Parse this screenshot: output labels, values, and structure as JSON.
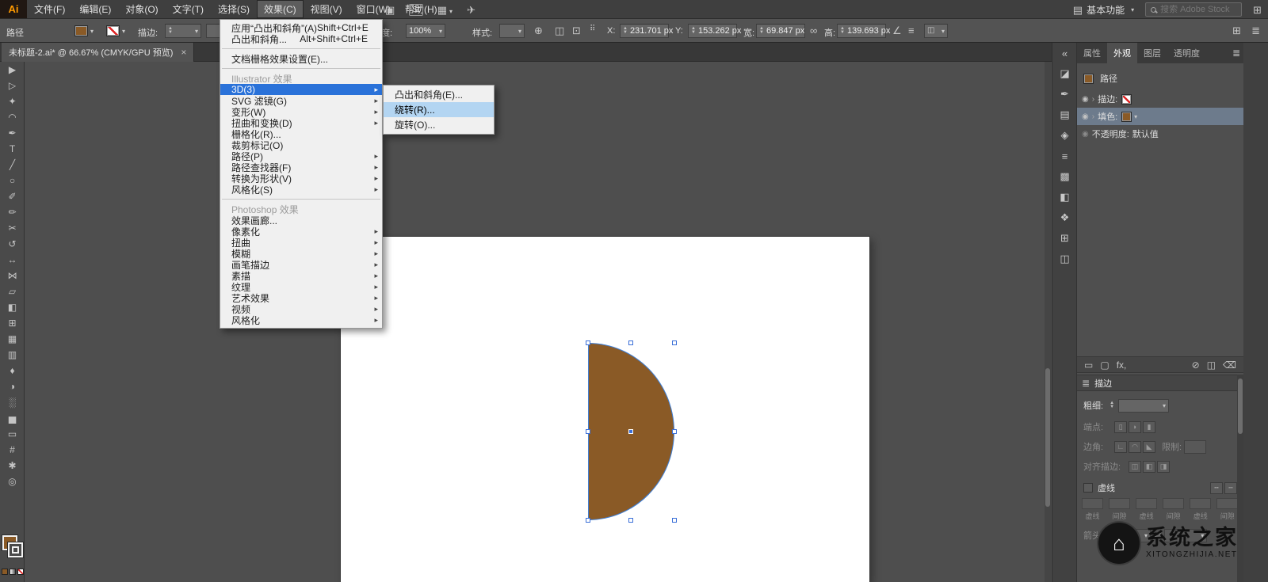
{
  "app": {
    "doc_tab_title": "未标题-2.ai* @ 66.67% (CMYK/GPU 预览)",
    "doc_tab_close": "×"
  },
  "colors": {
    "shape_brown": "#8a5a26",
    "selection_blue": "#3f7fd6",
    "menu_highlight": "#2a72d9",
    "menu_highlight_light": "#b3d5f2",
    "appearance_selected_row": "#6d7b8c"
  },
  "menubar": {
    "logo": "Ai",
    "menus": [
      {
        "label": "文件(F)"
      },
      {
        "label": "编辑(E)"
      },
      {
        "label": "对象(O)"
      },
      {
        "label": "文字(T)"
      },
      {
        "label": "选择(S)"
      },
      {
        "label": "效果(C)",
        "state": "active"
      },
      {
        "label": "视图(V)"
      },
      {
        "label": "窗口(W)"
      },
      {
        "label": "帮助(H)"
      }
    ],
    "stock_badge": "St",
    "workspace_label": "基本功能",
    "search_placeholder": "搜索 Adobe Stock"
  },
  "controlbar": {
    "object_label": "路径",
    "stroke_label": "描边:",
    "opacity_label": "不透明度:",
    "opacity_value": "100%",
    "style_label": "样式:",
    "x_label": "X:",
    "x_value": "231.701 px",
    "y_label": "Y:",
    "y_value": "153.262 px",
    "w_label": "宽:",
    "w_value": "69.847 px",
    "h_label": "高:",
    "h_value": "139.693 px"
  },
  "toolbar": {
    "tools": [
      {
        "name": "selection-tool",
        "glyph": "▶"
      },
      {
        "name": "direct-selection-tool",
        "glyph": "▷"
      },
      {
        "name": "magic-wand-tool",
        "glyph": "✦"
      },
      {
        "name": "lasso-tool",
        "glyph": "◠"
      },
      {
        "name": "pen-tool",
        "glyph": "✒"
      },
      {
        "name": "type-tool",
        "glyph": "T"
      },
      {
        "name": "line-segment-tool",
        "glyph": "╱"
      },
      {
        "name": "ellipse-tool",
        "glyph": "○"
      },
      {
        "name": "paintbrush-tool",
        "glyph": "✐"
      },
      {
        "name": "pencil-tool",
        "glyph": "✏"
      },
      {
        "name": "scissors-tool",
        "glyph": "✂"
      },
      {
        "name": "rotate-tool",
        "glyph": "↺"
      },
      {
        "name": "scale-tool",
        "glyph": "↔"
      },
      {
        "name": "width-tool",
        "glyph": "⋈"
      },
      {
        "name": "free-transform-tool",
        "glyph": "▱"
      },
      {
        "name": "shape-builder-tool",
        "glyph": "◧"
      },
      {
        "name": "perspective-grid-tool",
        "glyph": "⊞"
      },
      {
        "name": "mesh-tool",
        "glyph": "▦"
      },
      {
        "name": "gradient-tool",
        "glyph": "▥"
      },
      {
        "name": "eyedropper-tool",
        "glyph": "♦"
      },
      {
        "name": "blend-tool",
        "glyph": "◑"
      },
      {
        "name": "symbol-sprayer-tool",
        "glyph": "░"
      },
      {
        "name": "column-graph-tool",
        "glyph": "▅"
      },
      {
        "name": "artboard-tool",
        "glyph": "▭"
      },
      {
        "name": "slice-tool",
        "glyph": "#"
      },
      {
        "name": "hand-tool",
        "glyph": "✱"
      },
      {
        "name": "zoom-tool",
        "glyph": "◎"
      }
    ]
  },
  "effect_menu": {
    "items": [
      {
        "label": "应用“凸出和斜角”(A)",
        "shortcut": "Shift+Ctrl+E"
      },
      {
        "label": "凸出和斜角...",
        "shortcut": "Alt+Shift+Ctrl+E"
      },
      {
        "type": "separator"
      },
      {
        "label": "文档栅格效果设置(E)..."
      },
      {
        "type": "separator"
      },
      {
        "label": "Illustrator 效果",
        "type": "header"
      },
      {
        "label": "3D(3)",
        "state": "highlighted",
        "submenu": true
      },
      {
        "label": "SVG 滤镜(G)",
        "submenu": true
      },
      {
        "label": "变形(W)",
        "submenu": true
      },
      {
        "label": "扭曲和变换(D)",
        "submenu": true
      },
      {
        "label": "栅格化(R)..."
      },
      {
        "label": "裁剪标记(O)"
      },
      {
        "label": "路径(P)",
        "submenu": true
      },
      {
        "label": "路径查找器(F)",
        "submenu": true
      },
      {
        "label": "转换为形状(V)",
        "submenu": true
      },
      {
        "label": "风格化(S)",
        "submenu": true
      },
      {
        "type": "separator"
      },
      {
        "label": "Photoshop 效果",
        "type": "header"
      },
      {
        "label": "效果画廊..."
      },
      {
        "label": "像素化",
        "submenu": true
      },
      {
        "label": "扭曲",
        "submenu": true
      },
      {
        "label": "模糊",
        "submenu": true
      },
      {
        "label": "画笔描边",
        "submenu": true
      },
      {
        "label": "素描",
        "submenu": true
      },
      {
        "label": "纹理",
        "submenu": true
      },
      {
        "label": "艺术效果",
        "submenu": true
      },
      {
        "label": "视频",
        "submenu": true
      },
      {
        "label": "风格化",
        "submenu": true
      }
    ]
  },
  "submenu_3d": {
    "items": [
      {
        "label": "凸出和斜角(E)..."
      },
      {
        "label": "绕转(R)...",
        "state": "highlighted"
      },
      {
        "label": "旋转(O)..."
      }
    ]
  },
  "dock": {
    "collapse_icon": "«",
    "icons": [
      {
        "name": "color-panel-icon",
        "glyph": "◪"
      },
      {
        "name": "brushes-panel-icon",
        "glyph": "✒"
      },
      {
        "name": "swatches-panel-icon",
        "glyph": "▤"
      },
      {
        "name": "symbols-panel-icon",
        "glyph": "◈"
      },
      {
        "name": "stroke-panel-icon",
        "glyph": "≡"
      },
      {
        "name": "gradient-panel-icon",
        "glyph": "▩"
      },
      {
        "name": "transparency-panel-icon",
        "glyph": "◧"
      },
      {
        "name": "graphic-styles-panel-icon",
        "glyph": "❖"
      },
      {
        "name": "align-panel-icon",
        "glyph": "⊞"
      },
      {
        "name": "pathfinder-panel-icon",
        "glyph": "◫"
      }
    ]
  },
  "panels": {
    "tabs": [
      {
        "label": "属性"
      },
      {
        "label": "外观",
        "state": "active"
      },
      {
        "label": "图层"
      },
      {
        "label": "透明度"
      }
    ],
    "appearance": {
      "target_label": "路径",
      "stroke_row_label": "描边:",
      "fill_row_label": "填色:",
      "opacity_row_label": "不透明度:",
      "opacity_row_value": "默认值",
      "fx_label": "fx,"
    },
    "stroke": {
      "title": "描边",
      "weight_label": "粗细:",
      "cap_label": "端点:",
      "corner_label": "边角:",
      "miter_label": "限制:",
      "align_label": "对齐描边:",
      "dashed_label": "虚线",
      "dash_fields": [
        "虚线",
        "间隙",
        "虚线",
        "间隙",
        "虚线",
        "间隙"
      ],
      "arrow_label": "箭头:"
    }
  },
  "watermark": {
    "brand": "系统之家",
    "site": "XITONGZHIJIA.NET",
    "logo_glyph": "⌂"
  }
}
